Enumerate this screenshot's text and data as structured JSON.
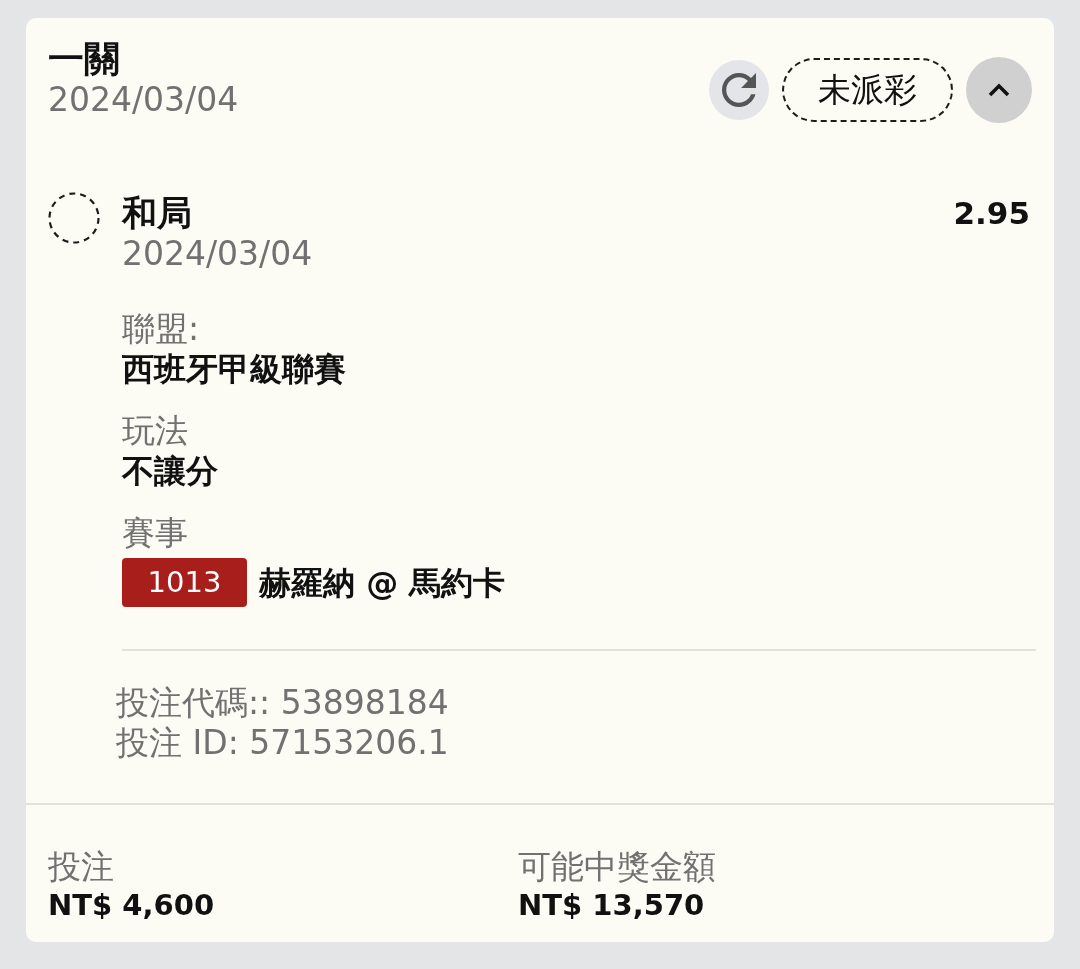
{
  "bet": {
    "title": "一關",
    "date": "2024/03/04",
    "status": "未派彩",
    "expanded": true
  },
  "selection": {
    "name": "和局",
    "date": "2024/03/04",
    "odds": "2.95"
  },
  "details": [
    {
      "label": "聯盟:",
      "value": "西班牙甲級聯賽"
    },
    {
      "label": "玩法",
      "value": "不讓分"
    },
    {
      "label": "賽事",
      "badge": "1013",
      "value": "赫羅納 @ 馬約卡"
    }
  ],
  "references": [
    "投注代碼:: 53898184",
    "投注 ID: 57153206.1"
  ],
  "footer": [
    {
      "label": "投注",
      "value": "NT$ 4,600"
    },
    {
      "label": "可能中獎金額",
      "value": "NT$ 13,570"
    }
  ]
}
